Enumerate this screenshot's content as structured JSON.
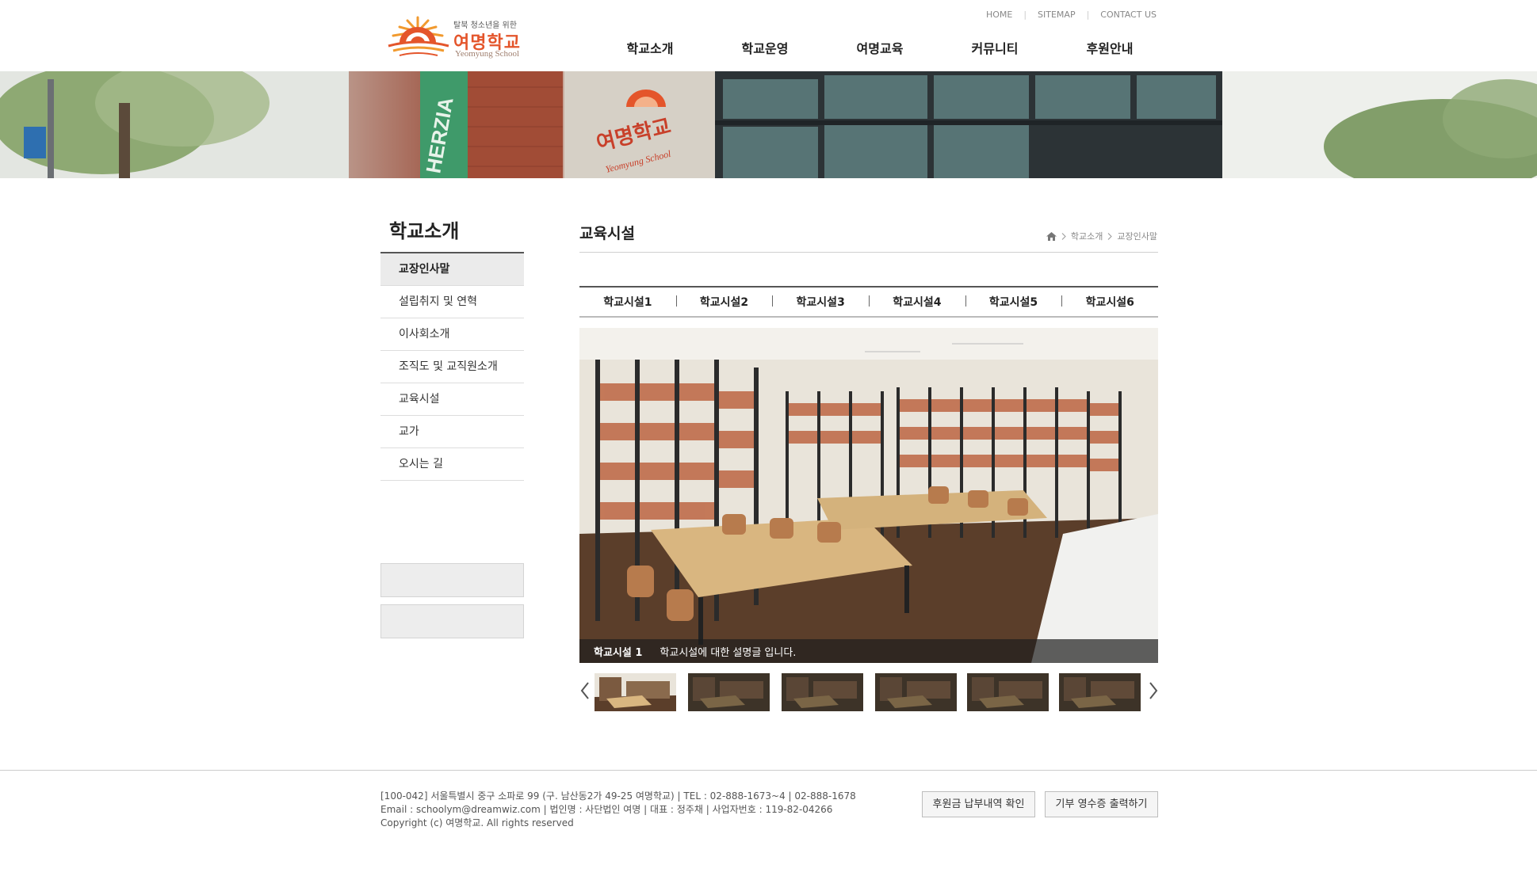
{
  "header": {
    "logo": {
      "tagline": "탈북 청소년을 위한",
      "name": "여명학교",
      "name_en": "Yeomyung School"
    },
    "util_links": [
      "HOME",
      "SITEMAP",
      "CONTACT US"
    ],
    "gnb": [
      "학교소개",
      "학교운영",
      "여명교육",
      "커뮤니티",
      "후원안내"
    ]
  },
  "banner": {
    "building_sign": "여명학교",
    "building_sign_en": "Yeomyung School",
    "side_sign": "HERZIA"
  },
  "sidebar": {
    "title": "학교소개",
    "items": [
      {
        "label": "교장인사말",
        "active": true
      },
      {
        "label": "설립취지 및 연혁",
        "active": false
      },
      {
        "label": "이사회소개",
        "active": false
      },
      {
        "label": "조직도 및 교직원소개",
        "active": false
      },
      {
        "label": "교육시설",
        "active": false
      },
      {
        "label": "교가",
        "active": false
      },
      {
        "label": "오시는 길",
        "active": false
      }
    ]
  },
  "content": {
    "title": "교육시설",
    "breadcrumb": [
      "학교소개",
      "교장인사말"
    ],
    "tabs": [
      "학교시설1",
      "학교시설2",
      "학교시설3",
      "학교시설4",
      "학교시설5",
      "학교시설6"
    ],
    "caption": {
      "title": "학교시설 1",
      "text": "학교시설에 대한 설명글 입니다."
    }
  },
  "footer": {
    "lines": [
      "[100-042] 서울특별시 중구 소파로 99 (구. 남산동2가 49-25 여명학교) | TEL : 02-888-1673~4 | 02-888-1678",
      "Email : schoolym@dreamwiz.com | 법인명 : 사단법인 여명 | 대표 : 정주채 | 사업자번호 : 119-82-04266",
      "Copyright (c) 여명학교. All rights reserved"
    ],
    "buttons": [
      "후원금 납부내역 확인",
      "기부 영수증 출력하기"
    ]
  },
  "colors": {
    "brand": "#e4552b",
    "sun": "#f19a2f",
    "active_bg": "#ebebeb"
  },
  "icons": [
    "sun-logo-icon",
    "home-icon",
    "chevron-right-icon",
    "arrow-left-icon",
    "arrow-right-icon"
  ]
}
